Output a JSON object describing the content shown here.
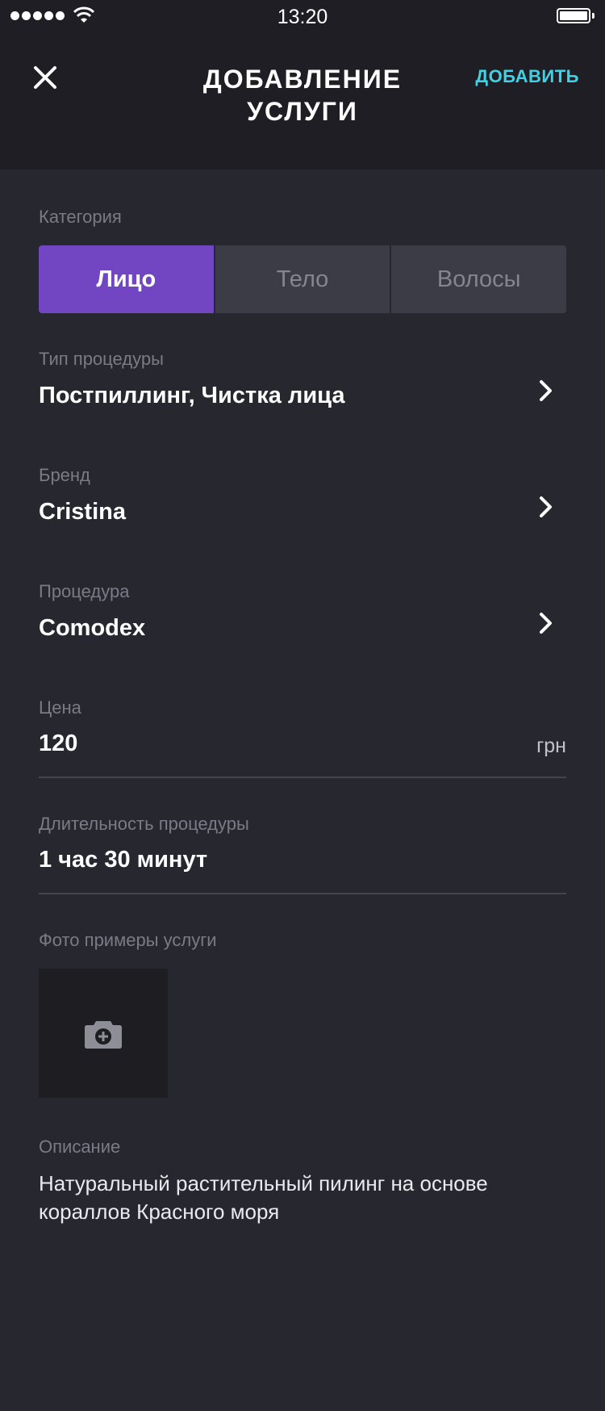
{
  "status_bar": {
    "time": "13:20"
  },
  "header": {
    "title": "ДОБАВЛЕНИЕ\nУСЛУГИ",
    "add_label": "ДОБАВИТЬ"
  },
  "category": {
    "label": "Категория",
    "options": [
      "Лицо",
      "Тело",
      "Волосы"
    ],
    "selected": "Лицо"
  },
  "procedure_type": {
    "label": "Тип процедуры",
    "value": "Постпиллинг, Чистка лица"
  },
  "brand": {
    "label": "Бренд",
    "value": "Cristina"
  },
  "procedure": {
    "label": "Процедура",
    "value": "Comodex"
  },
  "price": {
    "label": "Цена",
    "value": "120",
    "unit": "грн"
  },
  "duration": {
    "label": "Длительность процедуры",
    "value": "1 час 30 минут"
  },
  "photos": {
    "label": "Фото примеры услуги"
  },
  "description": {
    "label": "Описание",
    "value": "Натуральный растительный пилинг на основе кораллов Красного моря"
  },
  "colors": {
    "accent": "#7246c2",
    "link": "#3fd2e6",
    "background": "#272730",
    "header": "#1e1e24"
  }
}
